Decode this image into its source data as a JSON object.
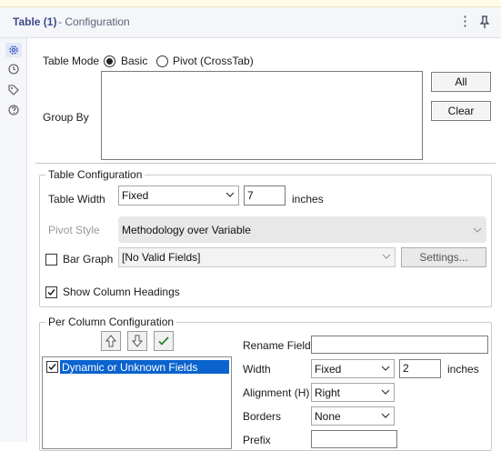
{
  "header": {
    "title": "Table (1)",
    "subtitle": "- Configuration"
  },
  "sidebar": {
    "icons": [
      "gear-icon",
      "history-icon",
      "tag-icon",
      "help-icon"
    ]
  },
  "table_mode": {
    "label": "Table Mode",
    "options": [
      {
        "label": "Basic",
        "selected": true
      },
      {
        "label": "Pivot (CrossTab)",
        "selected": false
      }
    ]
  },
  "group_by": {
    "label": "Group By",
    "value": "",
    "all_button": "All",
    "clear_button": "Clear"
  },
  "table_config": {
    "legend": "Table Configuration",
    "width_label": "Table Width",
    "width_mode": "Fixed",
    "width_value": "7",
    "width_unit": "inches",
    "pivot_style_label": "Pivot Style",
    "pivot_style_value": "Methodology over Variable",
    "bar_graph_label": "Bar Graph",
    "bar_graph_checked": false,
    "bar_graph_field": "[No Valid Fields]",
    "settings_button": "Settings...",
    "show_headings_label": "Show Column Headings",
    "show_headings_checked": true
  },
  "per_column": {
    "legend": "Per Column Configuration",
    "toolbar": [
      "move-up-icon",
      "move-down-icon",
      "check-all-icon"
    ],
    "fields": [
      {
        "label": "Dynamic or Unknown Fields",
        "checked": true,
        "selected": true
      }
    ],
    "rename_label": "Rename Field",
    "rename_value": "",
    "width_label": "Width",
    "width_mode": "Fixed",
    "width_value": "2",
    "width_unit": "inches",
    "alignment_label": "Alignment (H)",
    "alignment_value": "Right",
    "borders_label": "Borders",
    "borders_value": "None",
    "prefix_label": "Prefix",
    "prefix_value": ""
  }
}
